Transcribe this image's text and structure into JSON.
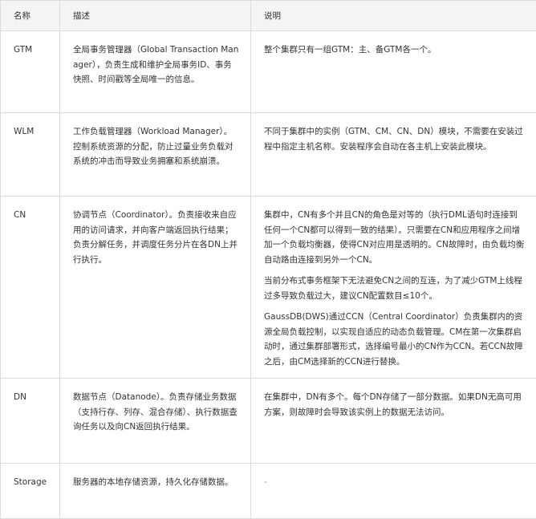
{
  "headers": {
    "name": "名称",
    "desc": "描述",
    "note": "说明"
  },
  "rows": [
    {
      "name": "GTM",
      "desc": "全局事务管理器（Global Transaction Manager），负责生成和维护全局事务ID、事务快照、时间戳等全局唯一的信息。",
      "notes": [
        "整个集群只有一组GTM：主、备GTM各一个。"
      ]
    },
    {
      "name": "WLM",
      "desc": "工作负载管理器（Workload Manager）。控制系统资源的分配，防止过量业务负载对系统的冲击而导致业务拥塞和系统崩溃。",
      "notes": [
        "不同于集群中的实例（GTM、CM、CN、DN）模块，不需要在安装过程中指定主机名称。安装程序会自动在各主机上安装此模块。"
      ]
    },
    {
      "name": "CN",
      "desc": "协调节点（Coordinator）。负责接收来自应用的访问请求，并向客户端返回执行结果；负责分解任务，并调度任务分片在各DN上并行执行。",
      "notes": [
        "集群中，CN有多个并且CN的角色是对等的（执行DML语句时连接到任何一个CN都可以得到一致的结果）。只需要在CN和应用程序之间增加一个负载均衡器，使得CN对应用是透明的。CN故障时，由负载均衡自动路由连接到另外一个CN。",
        "当前分布式事务框架下无法避免CN之间的互连，为了减少GTM上线程过多导致负载过大，建议CN配置数目≤10个。",
        "GaussDB(DWS)通过CCN（Central Coordinator）负责集群内的资源全局负载控制，以实现自适应的动态负载管理。CM在第一次集群启动时，通过集群部署形式，选择编号最小的CN作为CCN。若CCN故障之后，由CM选择新的CCN进行替换。"
      ]
    },
    {
      "name": "DN",
      "desc": "数据节点（Datanode）。负责存储业务数据（支持行存、列存、混合存储）、执行数据查询任务以及向CN返回执行结果。",
      "notes": [
        "在集群中，DN有多个。每个DN存储了一部分数据。如果DN无高可用方案，则故障时会导致该实例上的数据无法访问。"
      ]
    },
    {
      "name": "Storage",
      "desc": "服务器的本地存储资源，持久化存储数据。",
      "notes": [
        "-"
      ]
    }
  ]
}
